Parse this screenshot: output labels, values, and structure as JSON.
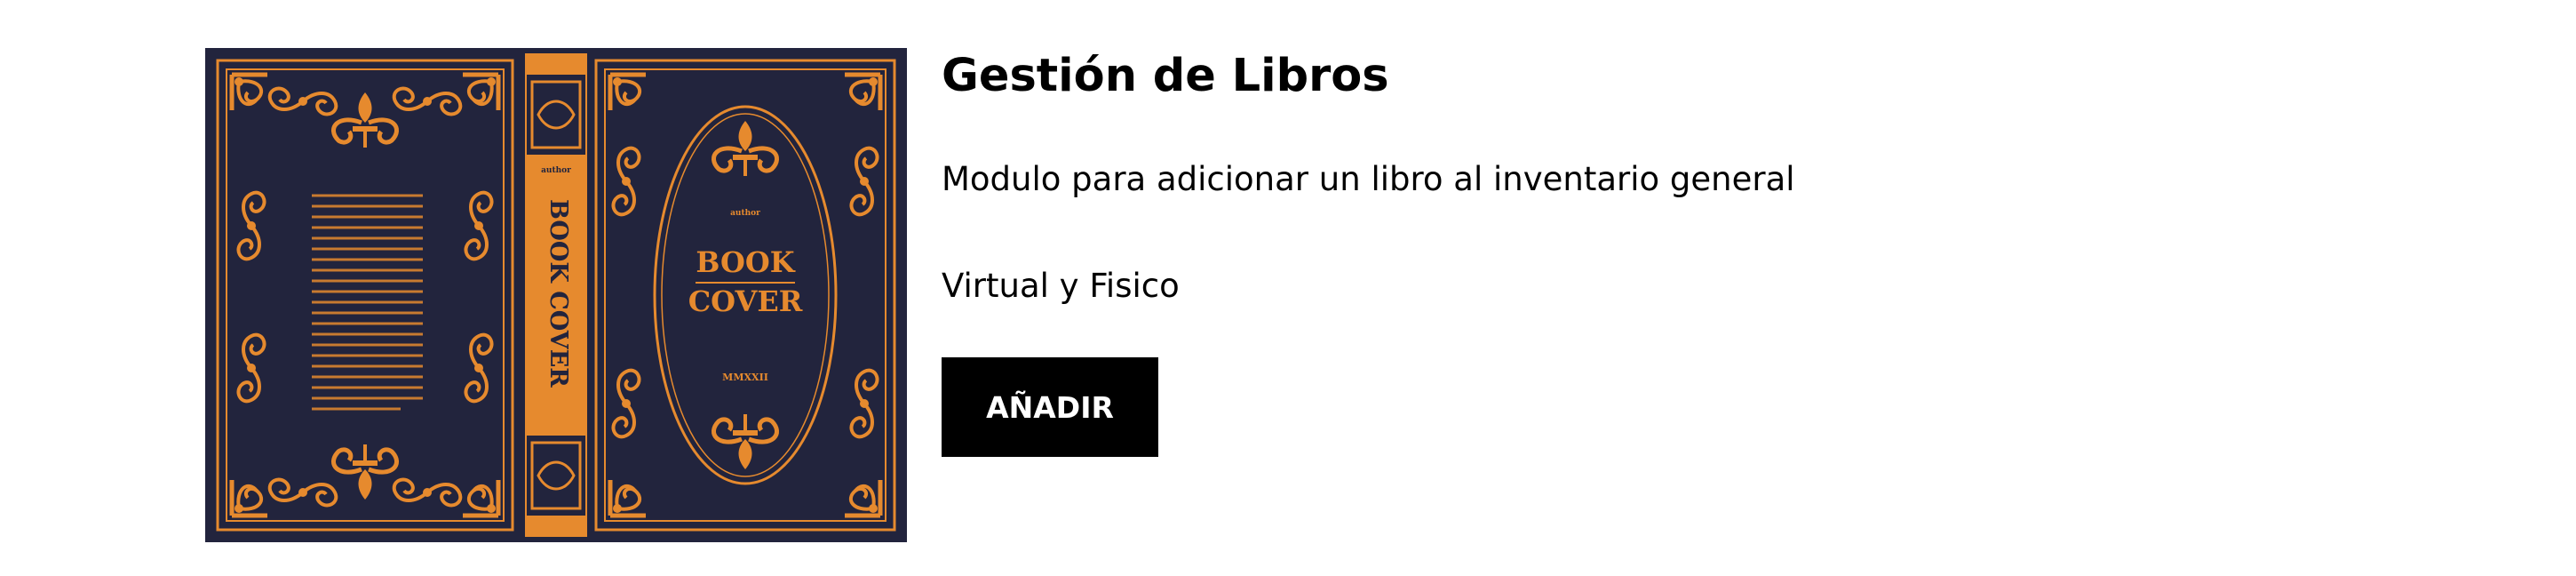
{
  "product": {
    "title": "Gestión de Libros",
    "description": "Modulo para adicionar un libro al inventario general",
    "format": "Virtual y Fisico",
    "add_button_label": "AÑADIR"
  },
  "cover": {
    "spine_author": "author",
    "spine_title": "BOOK COVER",
    "front_author": "author",
    "front_title_line1": "BOOK",
    "front_title_line2": "COVER",
    "front_year": "MMXXII",
    "colors": {
      "background": "#22243d",
      "ornament": "#e68a2e"
    }
  }
}
